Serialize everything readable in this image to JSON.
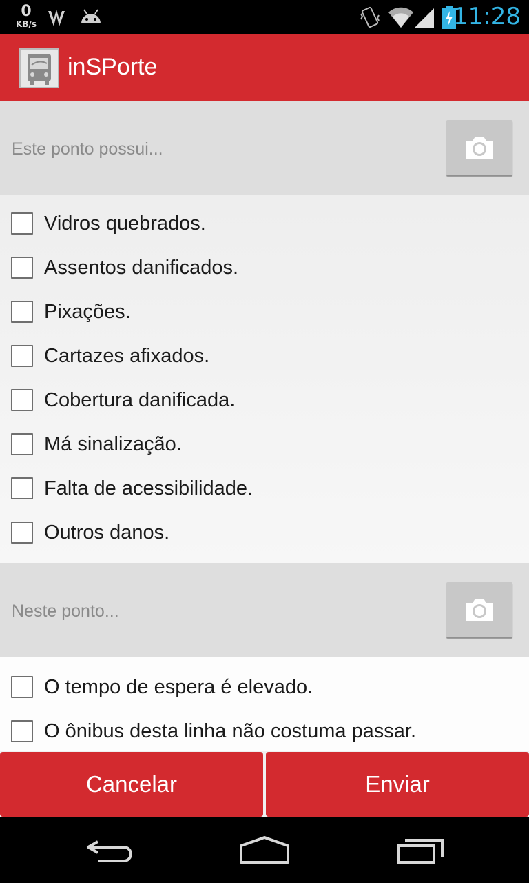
{
  "status_bar": {
    "speed_value": "0",
    "speed_unit": "KB/s",
    "time": "11:28",
    "clock_color": "#33b5e5"
  },
  "action_bar": {
    "title": "inSPorte",
    "color": "#d32a2f",
    "icon": "bus-icon"
  },
  "section1": {
    "hint": "Este ponto possui...",
    "camera_icon": "camera-icon",
    "items": [
      {
        "label": "Vidros quebrados.",
        "checked": false
      },
      {
        "label": "Assentos danificados.",
        "checked": false
      },
      {
        "label": "Pixações.",
        "checked": false
      },
      {
        "label": "Cartazes afixados.",
        "checked": false
      },
      {
        "label": "Cobertura danificada.",
        "checked": false
      },
      {
        "label": "Má sinalização.",
        "checked": false
      },
      {
        "label": "Falta de acessibilidade.",
        "checked": false
      },
      {
        "label": "Outros danos.",
        "checked": false
      }
    ]
  },
  "section2": {
    "hint": "Neste ponto...",
    "camera_icon": "camera-icon",
    "items": [
      {
        "label": "O tempo de espera é elevado.",
        "checked": false
      },
      {
        "label": "O ônibus desta linha não costuma passar.",
        "checked": false
      }
    ]
  },
  "buttons": {
    "cancel": "Cancelar",
    "send": "Enviar"
  }
}
